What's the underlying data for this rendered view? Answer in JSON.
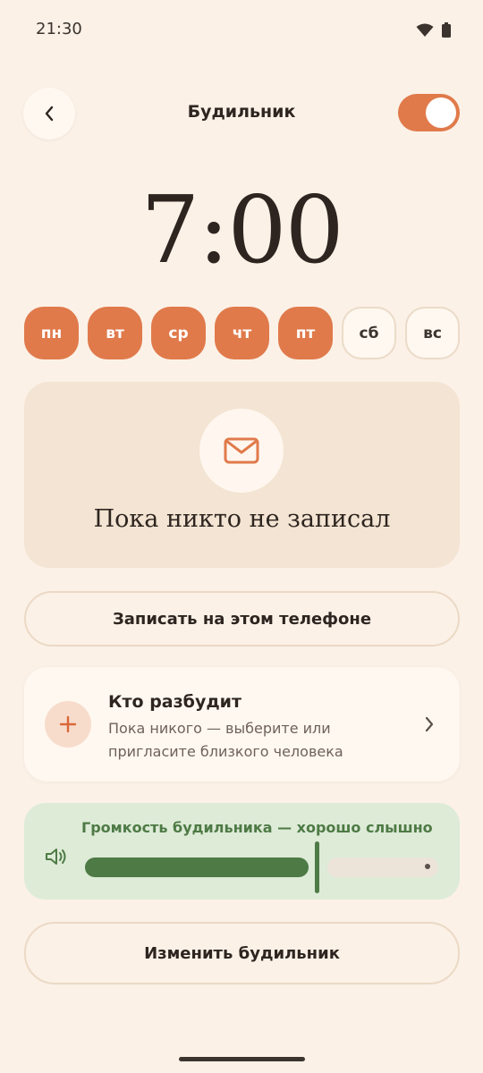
{
  "status_bar": {
    "time": "21:30"
  },
  "header": {
    "title": "Будильник",
    "alarm_enabled": true
  },
  "alarm": {
    "time": "7:00"
  },
  "days": [
    {
      "label": "пн",
      "active": true
    },
    {
      "label": "вт",
      "active": true
    },
    {
      "label": "ср",
      "active": true
    },
    {
      "label": "чт",
      "active": true
    },
    {
      "label": "пт",
      "active": true
    },
    {
      "label": "сб",
      "active": false
    },
    {
      "label": "вс",
      "active": false
    }
  ],
  "recordings": {
    "empty_text": "Пока никто не записал"
  },
  "record_button": {
    "label": "Записать на этом телефоне"
  },
  "who_wakes": {
    "title": "Кто разбудит",
    "subtitle": "Пока никого — выберите или пригласите близкого человека"
  },
  "volume": {
    "label": "Громкость будильника — хорошо слышно",
    "level": 0.73
  },
  "change_button": {
    "label": "Изменить будильник"
  },
  "colors": {
    "background": "#FBF1E7",
    "accent": "#E07A4B",
    "volume_green": "#4E7A45",
    "volume_bg": "#DDEBD7"
  }
}
